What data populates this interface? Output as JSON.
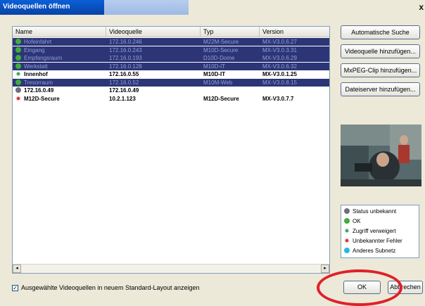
{
  "window": {
    "title": "Videoquellen öffnen",
    "close_glyph": "x"
  },
  "table": {
    "columns": [
      "Name",
      "Videoquelle",
      "Typ",
      "Version"
    ],
    "rows": [
      {
        "name": "Hofeinfahrt",
        "source": "172.16.0.246",
        "type": "M22M-Secure",
        "version": "MX-V3.0.6.27",
        "status": "ok",
        "selected": true
      },
      {
        "name": "Eingang",
        "source": "172.16.0.243",
        "type": "M10D-Secure",
        "version": "MX-V3.0.3.31",
        "status": "ok",
        "selected": true
      },
      {
        "name": "Empfangsraum",
        "source": "172.16.0.193",
        "type": "D10D-Dome",
        "version": "MX-V3.0.6.29",
        "status": "ok",
        "selected": true
      },
      {
        "name": "Werkstatt",
        "source": "172.16.0.128",
        "type": "M10D-IT",
        "version": "MX-V3.0.6.32",
        "status": "ok",
        "selected": true
      },
      {
        "name": "Innenhof",
        "source": "172.16.0.55",
        "type": "M10D-IT",
        "version": "MX-V3.0.1.25",
        "status": "denied",
        "selected": false
      },
      {
        "name": "Tresorraum",
        "source": "172.16.0.52",
        "type": "M10M-Web",
        "version": "MX-V3.0.8.15",
        "status": "ok",
        "selected": true
      },
      {
        "name": "172.16.0.49",
        "source": "172.16.0.49",
        "type": "",
        "version": "",
        "status": "unknown",
        "selected": false
      },
      {
        "name": "M12D-Secure",
        "source": "10.2.1.123",
        "type": "M12D-Secure",
        "version": "MX-V3.0.7.7",
        "status": "error",
        "selected": false
      }
    ],
    "scroll_left_glyph": "◂",
    "scroll_right_glyph": "▸"
  },
  "side_buttons": {
    "auto_search": "Automatische Suche",
    "add_source": "Videoquelle hinzufügen...",
    "add_mxpeg": "MxPEG-Clip hinzufügen...",
    "add_fileserver": "Dateiserver hinzufügen..."
  },
  "legend": [
    {
      "label": "Status unbekannt",
      "status": "unknown",
      "color": "#6d7078"
    },
    {
      "label": "OK",
      "status": "ok",
      "color": "#3fae3a"
    },
    {
      "label": "Zugriff verweigert",
      "status": "denied",
      "color": "#48a55a"
    },
    {
      "label": "Unbekannter Fehler",
      "status": "error",
      "color": "#d63b3b"
    },
    {
      "label": "Anderes Subnetz",
      "status": "subnet",
      "color": "#2ab6e0"
    }
  ],
  "footer": {
    "checkbox_label": "Ausgewählte Videoquellen in neuem Standard-Layout anzeigen",
    "checkbox_checked": true,
    "checkbox_glyph": "✓",
    "ok_label": "OK",
    "cancel_label": "Abbrechen"
  },
  "colors": {
    "selection": "#2d3577",
    "highlight_ring": "#e0202a",
    "title_bar": "#0a5fd8"
  }
}
